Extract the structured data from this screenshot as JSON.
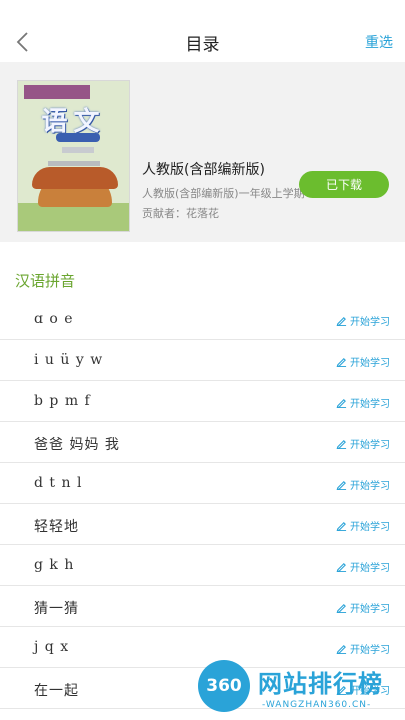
{
  "header": {
    "title": "目录",
    "reset_label": "重选"
  },
  "book": {
    "cover_title": "语文",
    "name": "人教版(含部编新版)",
    "edition": "人教版(含部编新版)一年级上学期",
    "contributor": "贡献者：花落花",
    "downloaded_label": "已下载"
  },
  "section": {
    "title": "汉语拼音"
  },
  "action_label": "开始学习",
  "lessons": [
    {
      "label": "ɑ o e"
    },
    {
      "label": "i u ü y w"
    },
    {
      "label": "b p m f"
    },
    {
      "label": "爸爸 妈妈 我"
    },
    {
      "label": "d t n l"
    },
    {
      "label": "轻轻地"
    },
    {
      "label": "g k h"
    },
    {
      "label": "猜一猜"
    },
    {
      "label": "j q x"
    },
    {
      "label": "在一起"
    }
  ],
  "watermark": {
    "logo": "360",
    "name": "网站排行榜",
    "url": "-WANGZHAN360.CN-"
  },
  "colors": {
    "accent": "#2aa3d8",
    "green": "#6bbd2e",
    "section": "#6aa52f"
  }
}
